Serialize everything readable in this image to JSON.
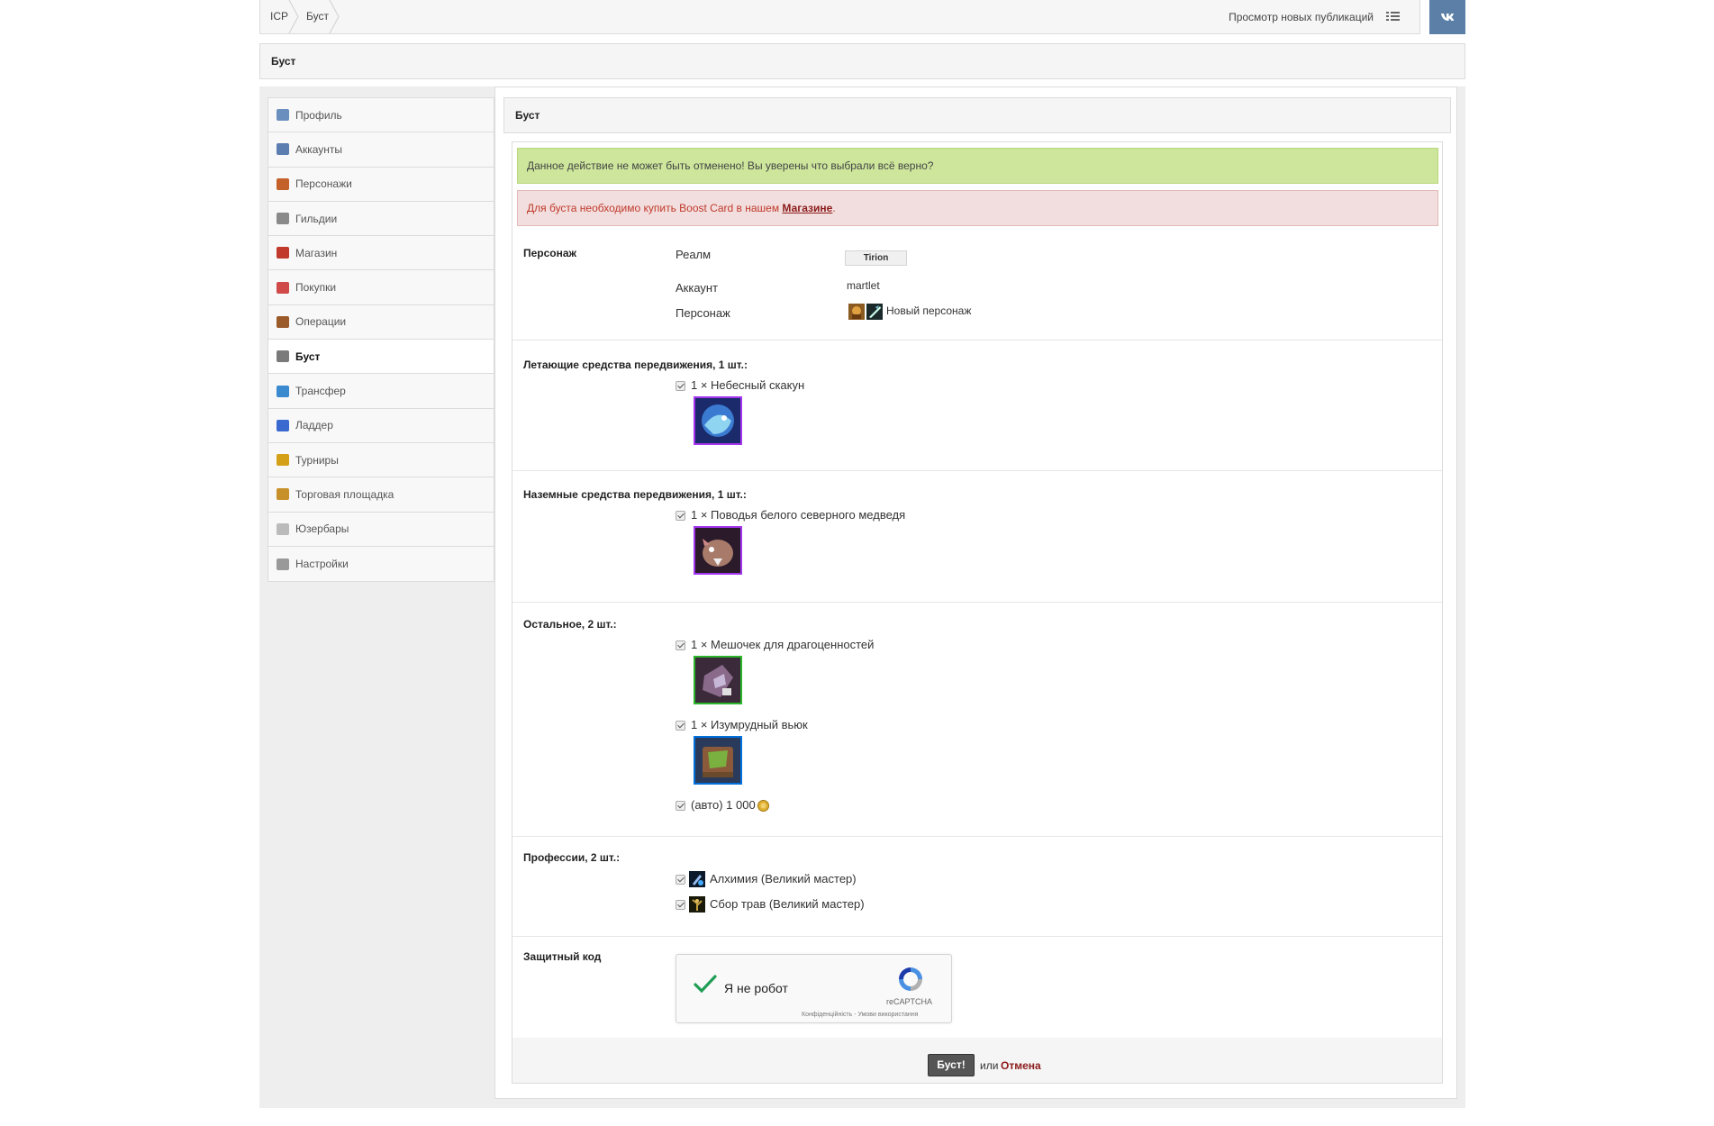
{
  "breadcrumb": {
    "home": "ICP",
    "current": "Буст"
  },
  "topbar": {
    "new_posts": "Просмотр новых публикаций",
    "vk": "ВК"
  },
  "page_title": "Буст",
  "sidebar": {
    "items": [
      {
        "label": "Профиль",
        "icon": "profile-card-icon",
        "color": "#6a8fbf"
      },
      {
        "label": "Аккаунты",
        "icon": "user-icon",
        "color": "#5b7db0"
      },
      {
        "label": "Персонажи",
        "icon": "users-icon",
        "color": "#c4602a"
      },
      {
        "label": "Гильдии",
        "icon": "tabard-icon",
        "color": "#8a8a8a"
      },
      {
        "label": "Магазин",
        "icon": "shop-icon",
        "color": "#c0392b"
      },
      {
        "label": "Покупки",
        "icon": "calendar-icon",
        "color": "#d04a4a"
      },
      {
        "label": "Операции",
        "icon": "wallet-icon",
        "color": "#9a5a2a"
      },
      {
        "label": "Буст",
        "icon": "rocket-icon",
        "color": "#7a7a7a"
      },
      {
        "label": "Трансфер",
        "icon": "transfer-icon",
        "color": "#3a8ad0"
      },
      {
        "label": "Ладдер",
        "icon": "chart-icon",
        "color": "#3a6ad0"
      },
      {
        "label": "Турниры",
        "icon": "trophy-icon",
        "color": "#d4a017"
      },
      {
        "label": "Торговая площадка",
        "icon": "scales-icon",
        "color": "#c8902a"
      },
      {
        "label": "Юзербары",
        "icon": "userbar-icon",
        "color": "#bbbbbb"
      },
      {
        "label": "Настройки",
        "icon": "gear-icon",
        "color": "#999999"
      }
    ],
    "active_index": 7
  },
  "content": {
    "title": "Буст",
    "alert_confirm": "Данное действие не может быть отменено! Вы уверены что выбрали всё верно?",
    "alert_boost_prefix": "Для буста необходимо купить Boost Card в нашем ",
    "alert_boost_link": "Магазине",
    "alert_boost_suffix": ".",
    "character": {
      "section_title": "Персонаж",
      "realm_label": "Реалм",
      "realm_value": "Tirion",
      "account_label": "Аккаунт",
      "account_value": "martlet",
      "char_label": "Персонаж",
      "char_value": "Новый персонаж"
    },
    "flying": {
      "title": "Летающие средства передвижения, 1 шт.:",
      "items": [
        {
          "text": "1 × Небесный скакун",
          "icon": "celestial-steed-icon"
        }
      ]
    },
    "ground": {
      "title": "Наземные средства передвижения, 1 шт.:",
      "items": [
        {
          "text": "1 × Поводья белого северного медведя",
          "icon": "polar-bear-icon"
        }
      ]
    },
    "other": {
      "title": "Остальное, 2 шт.:",
      "items": [
        {
          "text": "1 × Мешочек для драгоценностей",
          "icon": "gem-pouch-icon"
        },
        {
          "text": "1 × Изумрудный вьюк",
          "icon": "emerald-bag-icon"
        }
      ],
      "gold_text": "(авто) 1 000"
    },
    "professions": {
      "title": "Профессии, 2 шт.:",
      "items": [
        {
          "text": "Алхимия (Великий мастер)",
          "icon": "alchemy-icon"
        },
        {
          "text": "Сбор трав (Великий мастер)",
          "icon": "herbalism-icon"
        }
      ]
    },
    "captcha": {
      "section_title": "Защитный код",
      "label": "Я не робот",
      "brand": "reCAPTCHA",
      "links": "Конфіденційність - Умови використання"
    },
    "actions": {
      "submit": "Буст!",
      "or": "или",
      "cancel": "Отмена"
    }
  }
}
